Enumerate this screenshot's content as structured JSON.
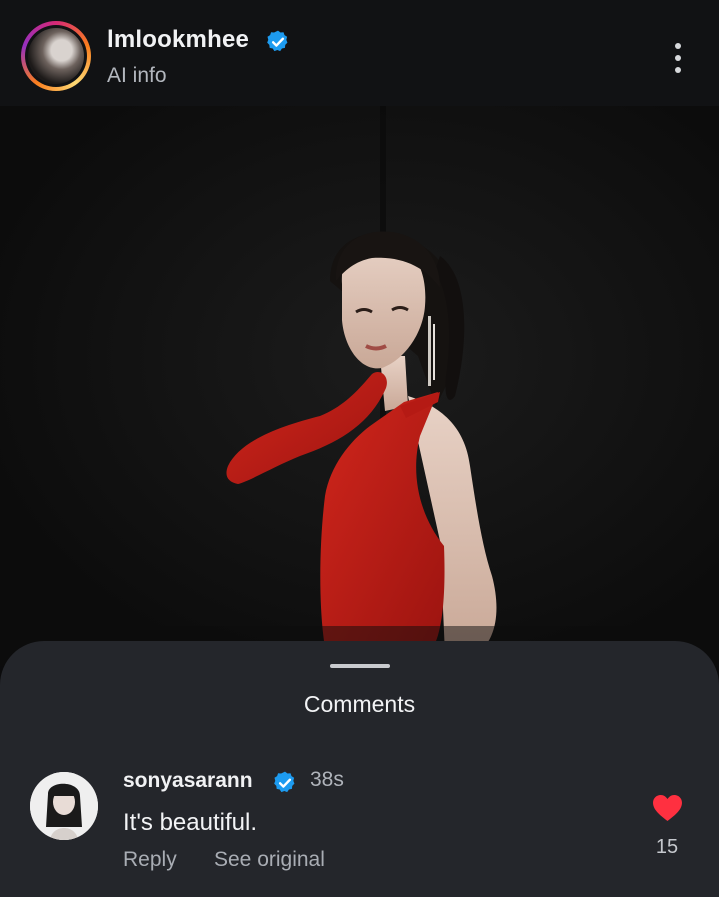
{
  "header": {
    "username": "lmlookmhee",
    "subtitle": "AI info",
    "verified": true
  },
  "post": {
    "image_description_icon": "photo"
  },
  "comments_sheet": {
    "title": "Comments",
    "comments": [
      {
        "username": "sonyasarann",
        "verified": true,
        "time": "38s",
        "text": "It's beautiful.",
        "reply_label": "Reply",
        "see_original_label": "See original",
        "like_count": "15",
        "liked": true
      }
    ]
  },
  "colors": {
    "verified_blue": "#1d9bf0",
    "heart_red": "#ff3040",
    "sheet_bg": "#24262b"
  }
}
